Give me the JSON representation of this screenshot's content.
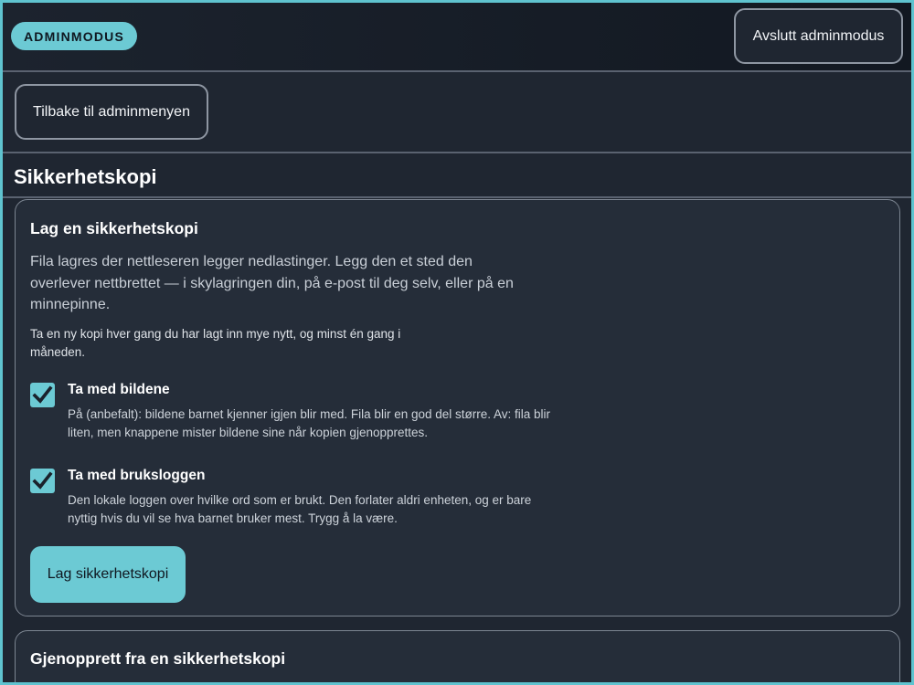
{
  "topbar": {
    "admin_badge": "ADMINMODUS",
    "exit_label": "Avslutt adminmodus"
  },
  "nav": {
    "back_label": "Tilbake til adminmenyen"
  },
  "section": {
    "title": "Sikkerhetskopi"
  },
  "backup_card": {
    "title": "Lag en sikkerhetskopi",
    "lead": "Fila lagres der nettleseren legger nedlastinger. Legg den et sted den overlever nettbrettet — i skylagringen din, på e-post til deg selv, eller på en minnepinne.",
    "note": "Ta en ny kopi hver gang du har lagt inn mye nytt, og minst én gang i måneden.",
    "options": [
      {
        "label": "Ta med bildene",
        "checked": true,
        "description": "På (anbefalt): bildene barnet kjenner igjen blir med. Fila blir en god del større. Av: fila blir liten, men knappene mister bildene sine når kopien gjenopprettes."
      },
      {
        "label": "Ta med bruksloggen",
        "checked": true,
        "description": "Den lokale loggen over hvilke ord som er brukt. Den forlater aldri enheten, og er bare nyttig hvis du vil se hva barnet bruker mest. Trygg å la være."
      }
    ],
    "button_label": "Lag sikkerhetskopi"
  },
  "restore_card": {
    "title": "Gjenopprett fra en sikkerhetskopi"
  },
  "colors": {
    "accent": "#6ccad4",
    "background": "#1f2631",
    "card": "#252d39",
    "border": "#8e96a2"
  },
  "icons": {
    "checkbox": "checkmark-icon"
  }
}
